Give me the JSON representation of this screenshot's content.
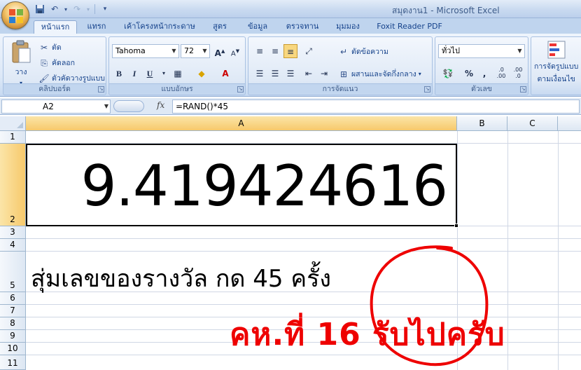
{
  "window": {
    "title": "สมุดงาน1 - Microsoft Excel"
  },
  "quick_access": [
    {
      "name": "save-icon",
      "glyph": "💾"
    },
    {
      "name": "undo-icon",
      "glyph": "↶"
    },
    {
      "name": "redo-icon",
      "glyph": "↷"
    },
    {
      "name": "customize-qat-icon",
      "glyph": "▾"
    }
  ],
  "tabs": [
    "หน้าแรก",
    "แทรก",
    "เค้าโครงหน้ากระดาษ",
    "สูตร",
    "ข้อมูล",
    "ตรวจทาน",
    "มุมมอง",
    "Foxit Reader PDF"
  ],
  "ribbon": {
    "clipboard": {
      "label": "คลิปบอร์ด",
      "paste": "วาง",
      "cut": "ตัด",
      "copy": "คัดลอก",
      "format_painter": "ตัวคัดวางรูปแบบ"
    },
    "font": {
      "label": "แบบอักษร",
      "font_name": "Tahoma",
      "font_size": "72",
      "bold": "B",
      "italic": "I",
      "underline": "U",
      "grow": "A",
      "shrink": "A"
    },
    "alignment": {
      "label": "การจัดแนว",
      "wrap": "ตัดข้อความ",
      "merge": "ผสานและจัดกึ่งกลาง"
    },
    "number": {
      "label": "ตัวเลข",
      "format": "ทั่วไป",
      "percent": "%",
      "comma": ",",
      "inc_decimal": ".0 .00",
      "dec_decimal": ".00 .0"
    },
    "styles": {
      "conditional_line1": "การจัดรูปแบบ",
      "conditional_line2": "ตามเงื่อนไข"
    }
  },
  "formula_bar": {
    "name_box": "A2",
    "fx": "fx",
    "formula": "=RAND()*45"
  },
  "columns": [
    "A",
    "B",
    "C"
  ],
  "rows": [
    "1",
    "2",
    "3",
    "4",
    "5",
    "6",
    "7",
    "8",
    "9",
    "10",
    "11"
  ],
  "cells": {
    "A2": "9.419424616",
    "A5": "สุ่มเลขของรางวัล กด 45 ครั้ง"
  },
  "overlay_text": "คห.ที่ 16 รับไปครับ",
  "colors": {
    "annotation_red": "#ee0000",
    "selection_header": "#f7c96b",
    "ribbon_blue": "#15428b"
  }
}
